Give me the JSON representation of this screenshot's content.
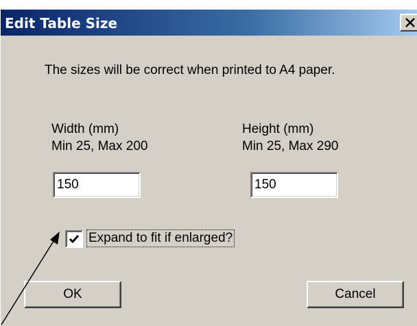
{
  "dialog": {
    "title": "Edit Table Size",
    "close_icon": "close-icon",
    "message": "The sizes will be correct when  printed to A4 paper."
  },
  "width": {
    "label": "Width (mm)",
    "range": "Min 25, Max 200",
    "value": "150"
  },
  "height": {
    "label": "Height (mm)",
    "range": "Min 25, Max 290",
    "value": "150"
  },
  "expand": {
    "label": "Expand to fit if enlarged?",
    "checked": true
  },
  "buttons": {
    "ok": "OK",
    "cancel": "Cancel"
  },
  "colors": {
    "title_gradient_start": "#0a246a",
    "title_gradient_end": "#a6caf0",
    "dialog_face": "#d4d0c8"
  }
}
